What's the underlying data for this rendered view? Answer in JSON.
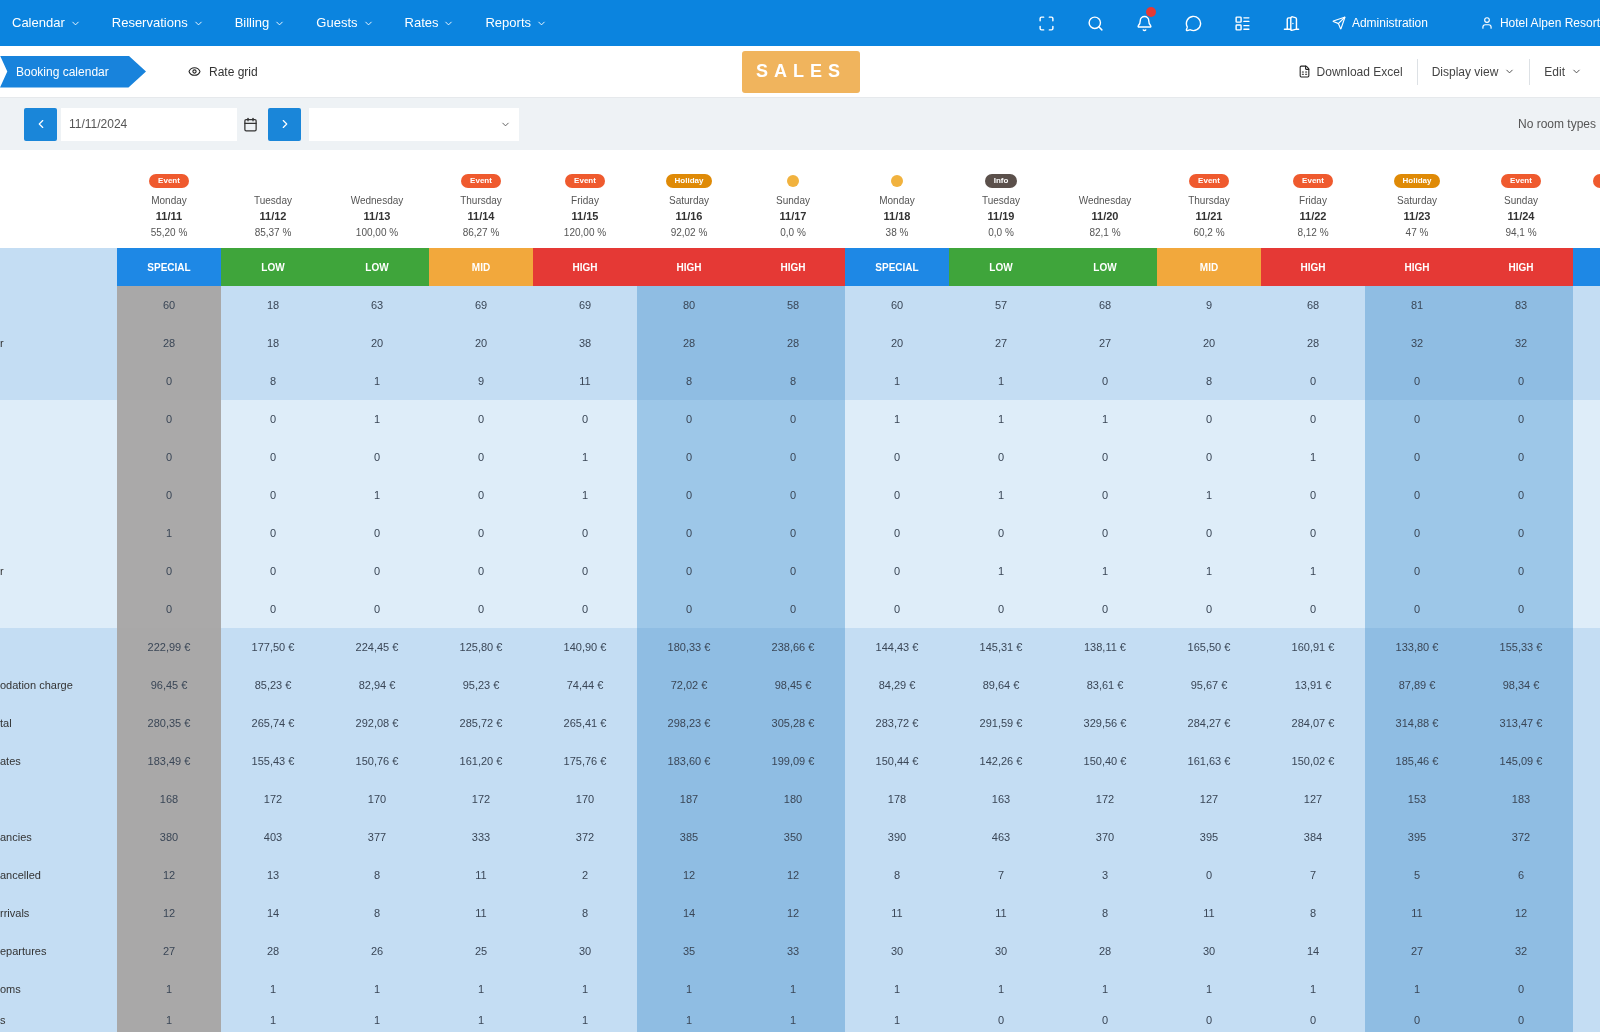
{
  "nav": {
    "items": [
      {
        "label": "Calendar"
      },
      {
        "label": "Reservations"
      },
      {
        "label": "Billing"
      },
      {
        "label": "Guests"
      },
      {
        "label": "Rates"
      },
      {
        "label": "Reports"
      }
    ],
    "notifications_unread": true,
    "admin_label": "Administration",
    "user_label": "Hotel Alpen Resort"
  },
  "subbar": {
    "breadcrumb": "Booking calendar",
    "view_link": "Rate grid",
    "logo": "SALES",
    "actions": [
      {
        "kind": "icon",
        "label": "Download Excel"
      },
      {
        "kind": "menu",
        "label": "Display view"
      },
      {
        "kind": "menu",
        "label": "Edit"
      }
    ]
  },
  "toolbar": {
    "date": "11/11/2024",
    "note": "No room types"
  },
  "table": {
    "days": [
      {
        "kind": "today",
        "badge": {
          "kind": "pill",
          "label": "Event",
          "color": "#ef5a2e"
        },
        "name": "Monday",
        "date": "11/11",
        "percent": "55,20 %",
        "band": {
          "label": "SPECIAL",
          "color": "#1e88e5"
        }
      },
      {
        "kind": "weekday",
        "name": "Tuesday",
        "date": "11/12",
        "percent": "85,37 %",
        "band": {
          "label": "LOW",
          "color": "#3fa53b"
        }
      },
      {
        "kind": "weekday",
        "name": "Wednesday",
        "date": "11/13",
        "percent": "100,00 %",
        "band": {
          "label": "LOW",
          "color": "#3fa53b"
        }
      },
      {
        "kind": "weekday",
        "badge": {
          "kind": "pill",
          "label": "Event",
          "color": "#ef5a2e"
        },
        "name": "Thursday",
        "date": "11/14",
        "percent": "86,27 %",
        "band": {
          "label": "MID",
          "color": "#f2a83c"
        }
      },
      {
        "kind": "weekday",
        "badge": {
          "kind": "pill",
          "label": "Event",
          "color": "#ef5a2e"
        },
        "name": "Friday",
        "date": "11/15",
        "percent": "120,00 %",
        "band": {
          "label": "HIGH",
          "color": "#e53935"
        }
      },
      {
        "kind": "weekend",
        "badge": {
          "kind": "pill",
          "label": "Holiday",
          "color": "#df8a06"
        },
        "name": "Saturday",
        "date": "11/16",
        "percent": "92,02 %",
        "band": {
          "label": "HIGH",
          "color": "#e53935"
        }
      },
      {
        "kind": "weekend",
        "badge": {
          "kind": "dot",
          "color": "#f1b23e"
        },
        "name": "Sunday",
        "date": "11/17",
        "percent": "0,0 %",
        "band": {
          "label": "HIGH",
          "color": "#e53935"
        }
      },
      {
        "kind": "weekday",
        "badge": {
          "kind": "dot",
          "color": "#f1b23e"
        },
        "name": "Monday",
        "date": "11/18",
        "percent": "38 %",
        "band": {
          "label": "SPECIAL",
          "color": "#1e88e5"
        }
      },
      {
        "kind": "weekday",
        "badge": {
          "kind": "pill",
          "label": "Info",
          "color": "#5b504b"
        },
        "name": "Tuesday",
        "date": "11/19",
        "percent": "0,0 %",
        "band": {
          "label": "LOW",
          "color": "#3fa53b"
        }
      },
      {
        "kind": "weekday",
        "name": "Wednesday",
        "date": "11/20",
        "percent": "82,1 %",
        "band": {
          "label": "LOW",
          "color": "#3fa53b"
        }
      },
      {
        "kind": "weekday",
        "badge": {
          "kind": "pill",
          "label": "Event",
          "color": "#ef5a2e"
        },
        "name": "Thursday",
        "date": "11/21",
        "percent": "60,2 %",
        "band": {
          "label": "MID",
          "color": "#f2a83c"
        }
      },
      {
        "kind": "weekday",
        "badge": {
          "kind": "pill",
          "label": "Event",
          "color": "#ef5a2e"
        },
        "name": "Friday",
        "date": "11/22",
        "percent": "8,12 %",
        "band": {
          "label": "HIGH",
          "color": "#e53935"
        }
      },
      {
        "kind": "weekend",
        "badge": {
          "kind": "pill",
          "label": "Holiday",
          "color": "#df8a06"
        },
        "name": "Saturday",
        "date": "11/23",
        "percent": "47 %",
        "band": {
          "label": "HIGH",
          "color": "#e53935"
        }
      },
      {
        "kind": "weekend",
        "badge": {
          "kind": "pill",
          "label": "Event",
          "color": "#ef5a2e"
        },
        "name": "Sunday",
        "date": "11/24",
        "percent": "94,1 %",
        "band": {
          "label": "HIGH",
          "color": "#e53935"
        }
      }
    ],
    "cut_day": {
      "badge": {
        "color": "#ef5a2e"
      },
      "band": {
        "color": "#1e88e5"
      }
    },
    "sections": [
      {
        "kind": "highlight",
        "rows": [
          {
            "cells": [
              "60",
              "18",
              "63",
              "69",
              "69",
              "80",
              "58",
              "60",
              "57",
              "68",
              "9",
              "68",
              "81",
              "83"
            ]
          },
          {
            "label": "r",
            "cells": [
              "28",
              "18",
              "20",
              "20",
              "38",
              "28",
              "28",
              "20",
              "27",
              "27",
              "20",
              "28",
              "32",
              "32"
            ]
          },
          {
            "cells": [
              "0",
              "8",
              "1",
              "9",
              "11",
              "8",
              "8",
              "1",
              "1",
              "0",
              "8",
              "0",
              "0",
              "0"
            ]
          }
        ]
      },
      {
        "kind": "plain",
        "rows": [
          {
            "cells": [
              "0",
              "0",
              "1",
              "0",
              "0",
              "0",
              "0",
              "1",
              "1",
              "1",
              "0",
              "0",
              "0",
              "0"
            ]
          },
          {
            "cells": [
              "0",
              "0",
              "0",
              "0",
              "1",
              "0",
              "0",
              "0",
              "0",
              "0",
              "0",
              "1",
              "0",
              "0"
            ]
          },
          {
            "cells": [
              "0",
              "0",
              "1",
              "0",
              "1",
              "0",
              "0",
              "0",
              "1",
              "0",
              "1",
              "0",
              "0",
              "0"
            ]
          },
          {
            "cells": [
              "1",
              "0",
              "0",
              "0",
              "0",
              "0",
              "0",
              "0",
              "0",
              "0",
              "0",
              "0",
              "0",
              "0"
            ]
          },
          {
            "label": "r",
            "cells": [
              "0",
              "0",
              "0",
              "0",
              "0",
              "0",
              "0",
              "0",
              "1",
              "1",
              "1",
              "1",
              "0",
              "0"
            ]
          },
          {
            "cells": [
              "0",
              "0",
              "0",
              "0",
              "0",
              "0",
              "0",
              "0",
              "0",
              "0",
              "0",
              "0",
              "0",
              "0"
            ]
          }
        ]
      },
      {
        "kind": "highlight",
        "rows": [
          {
            "cells": [
              "222,99 €",
              "177,50 €",
              "224,45 €",
              "125,80 €",
              "140,90 €",
              "180,33 €",
              "238,66 €",
              "144,43 €",
              "145,31 €",
              "138,11 €",
              "165,50 €",
              "160,91 €",
              "133,80 €",
              "155,33 €"
            ]
          },
          {
            "label": "odation charge",
            "cells": [
              "96,45 €",
              "85,23 €",
              "82,94 €",
              "95,23 €",
              "74,44 €",
              "72,02 €",
              "98,45 €",
              "84,29 €",
              "89,64 €",
              "83,61 €",
              "95,67 €",
              "13,91 €",
              "87,89 €",
              "98,34 €"
            ]
          },
          {
            "label": "tal",
            "cells": [
              "280,35 €",
              "265,74 €",
              "292,08 €",
              "285,72 €",
              "265,41 €",
              "298,23 €",
              "305,28 €",
              "283,72 €",
              "291,59 €",
              "329,56 €",
              "284,27 €",
              "284,07 €",
              "314,88 €",
              "313,47 €"
            ]
          },
          {
            "label": "ates",
            "cells": [
              "183,49 €",
              "155,43 €",
              "150,76 €",
              "161,20 €",
              "175,76 €",
              "183,60 €",
              "199,09 €",
              "150,44 €",
              "142,26 €",
              "150,40 €",
              "161,63 €",
              "150,02 €",
              "185,46 €",
              "145,09 €"
            ]
          },
          {
            "cells": [
              "168",
              "172",
              "170",
              "172",
              "170",
              "187",
              "180",
              "178",
              "163",
              "172",
              "127",
              "127",
              "153",
              "183"
            ]
          },
          {
            "label": "ancies",
            "cells": [
              "380",
              "403",
              "377",
              "333",
              "372",
              "385",
              "350",
              "390",
              "463",
              "370",
              "395",
              "384",
              "395",
              "372"
            ]
          },
          {
            "label": "ancelled",
            "cells": [
              "12",
              "13",
              "8",
              "11",
              "2",
              "12",
              "12",
              "8",
              "7",
              "3",
              "0",
              "7",
              "5",
              "6"
            ]
          },
          {
            "label": "rrivals",
            "cells": [
              "12",
              "14",
              "8",
              "11",
              "8",
              "14",
              "12",
              "11",
              "11",
              "8",
              "11",
              "8",
              "11",
              "12"
            ]
          },
          {
            "label": "epartures",
            "cells": [
              "27",
              "28",
              "26",
              "25",
              "30",
              "35",
              "33",
              "30",
              "30",
              "28",
              "30",
              "14",
              "27",
              "32"
            ]
          },
          {
            "label": "oms",
            "cells": [
              "1",
              "1",
              "1",
              "1",
              "1",
              "1",
              "1",
              "1",
              "1",
              "1",
              "1",
              "1",
              "1",
              "0"
            ]
          },
          {
            "label": "s",
            "cells": [
              "1",
              "1",
              "1",
              "1",
              "1",
              "1",
              "1",
              "1",
              "0",
              "0",
              "0",
              "0",
              "0",
              "0"
            ]
          }
        ]
      }
    ]
  }
}
